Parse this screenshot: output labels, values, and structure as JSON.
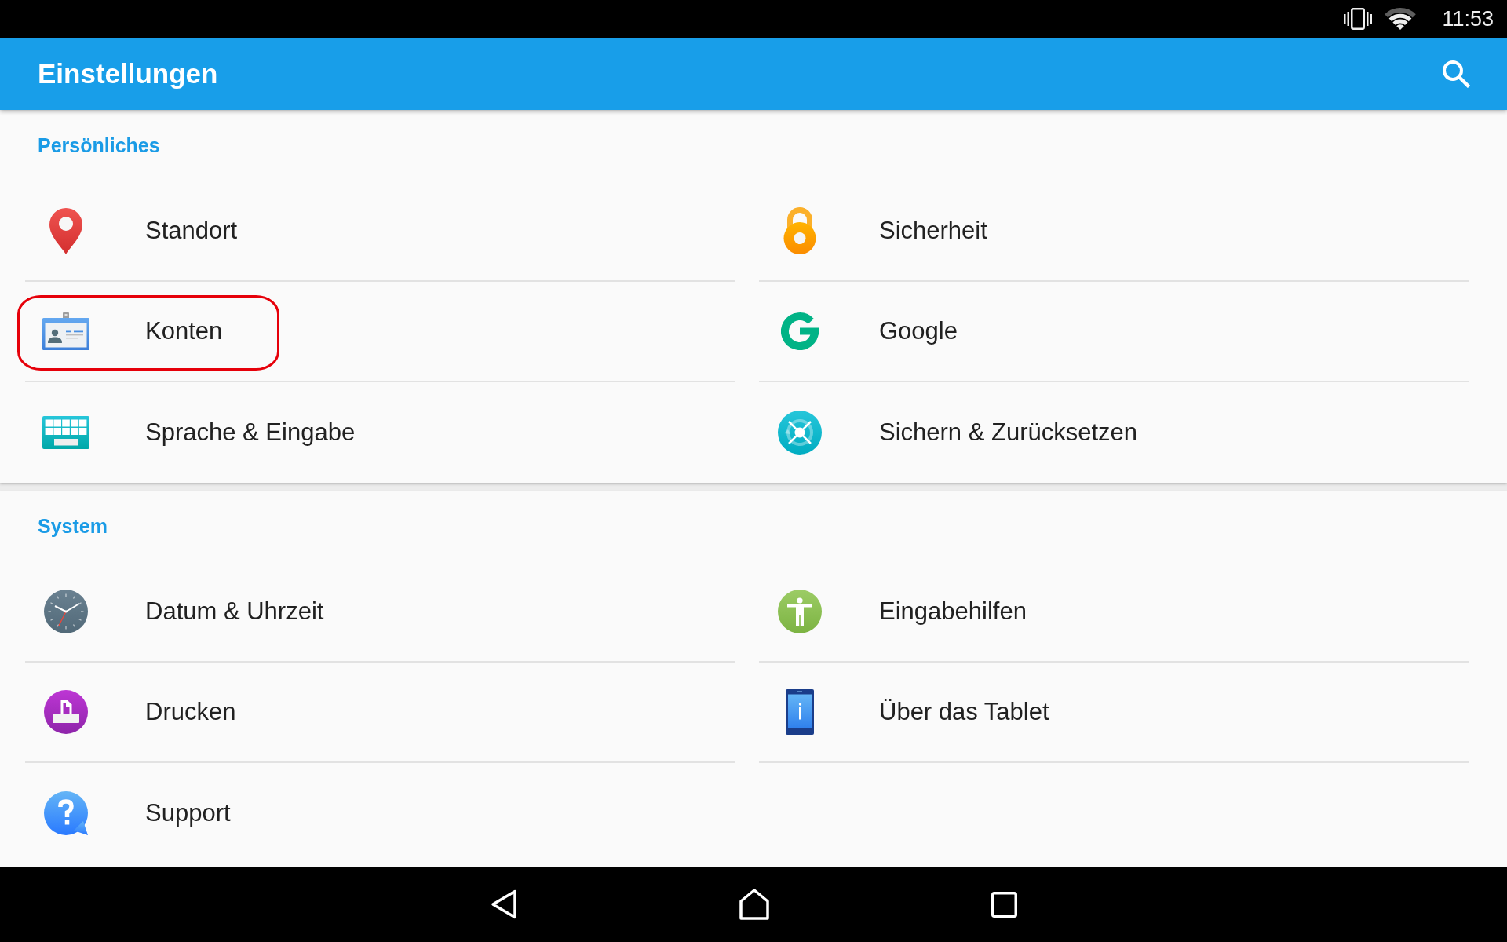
{
  "status_bar": {
    "time": "11:53"
  },
  "app_bar": {
    "title": "Einstellungen"
  },
  "sections": [
    {
      "title": "Persönliches",
      "items": [
        {
          "label": "Standort",
          "highlighted": false
        },
        {
          "label": "Sicherheit",
          "highlighted": false
        },
        {
          "label": "Konten",
          "highlighted": true
        },
        {
          "label": "Google",
          "highlighted": false
        },
        {
          "label": "Sprache & Eingabe",
          "highlighted": false
        },
        {
          "label": "Sichern & Zurücksetzen",
          "highlighted": false
        }
      ]
    },
    {
      "title": "System",
      "items": [
        {
          "label": "Datum & Uhrzeit",
          "highlighted": false
        },
        {
          "label": "Eingabehilfen",
          "highlighted": false
        },
        {
          "label": "Drucken",
          "highlighted": false
        },
        {
          "label": "Über das Tablet",
          "highlighted": false
        },
        {
          "label": "Support",
          "highlighted": false
        }
      ]
    }
  ]
}
